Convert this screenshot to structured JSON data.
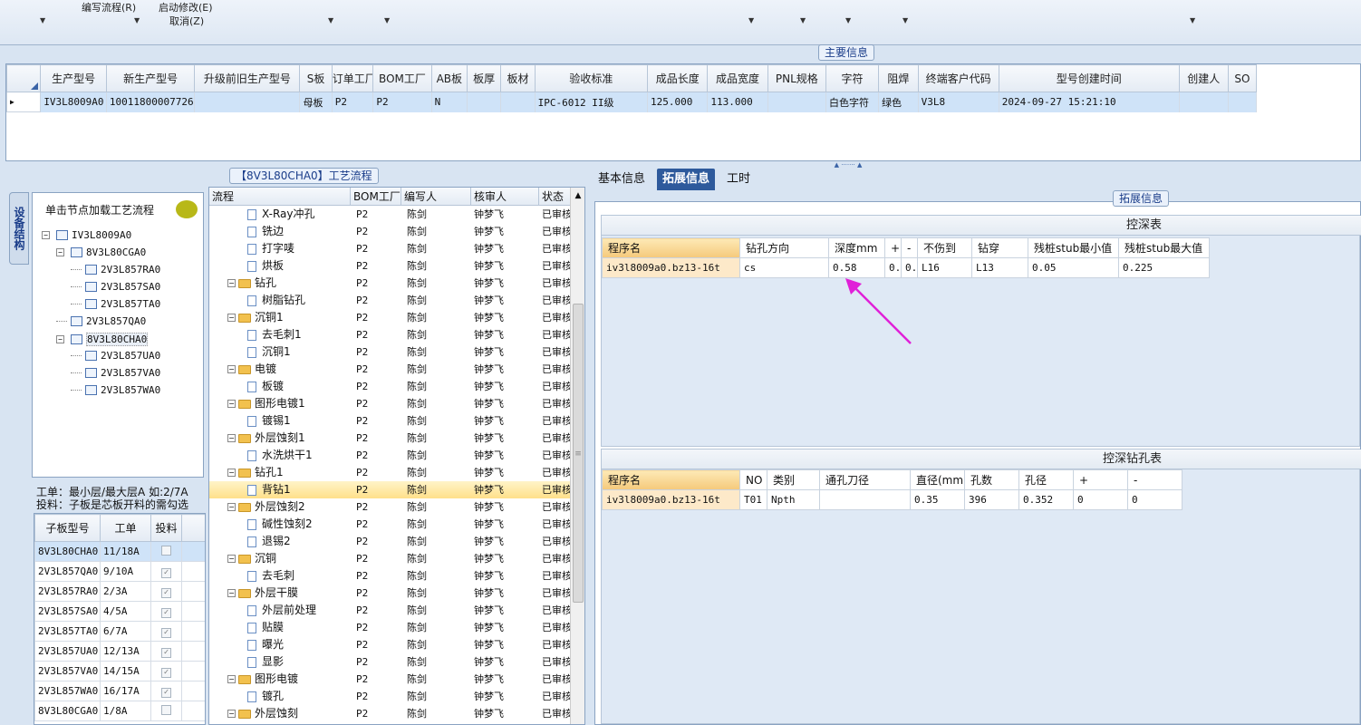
{
  "toolbar": {
    "edit_flow": "编写流程(R)",
    "start_modify": "启动修改(E)",
    "cancel": "取消(Z)"
  },
  "main_info": {
    "title": "主要信息",
    "columns": [
      "生产型号",
      "新生产型号",
      "升级前旧生产型号",
      "S板",
      "订单工厂",
      "BOM工厂",
      "AB板",
      "板厚",
      "板材",
      "验收标准",
      "成品长度",
      "成品宽度",
      "PNL规格",
      "字符",
      "阻焊",
      "终端客户代码",
      "型号创建时间",
      "创建人",
      "SO"
    ],
    "row": [
      "IV3L8009A0",
      "10011800007726",
      "",
      "母板",
      "P2",
      "P2",
      "N",
      "",
      "",
      "IPC-6012 II级",
      "125.000",
      "113.000",
      "",
      "白色字符",
      "绿色",
      "V3L8",
      "2024-09-27 15:21:10",
      "",
      ""
    ]
  },
  "left_panel": {
    "vtab": "设备结构",
    "hint": "单击节点加载工艺流程",
    "tree": [
      {
        "label": "IV3L8009A0",
        "level": 0
      },
      {
        "label": "8V3L80CGA0",
        "level": 1
      },
      {
        "label": "2V3L857RA0",
        "level": 2
      },
      {
        "label": "2V3L857SA0",
        "level": 2
      },
      {
        "label": "2V3L857TA0",
        "level": 2
      },
      {
        "label": "2V3L857QA0",
        "level": 1
      },
      {
        "label": "8V3L80CHA0",
        "level": 1
      },
      {
        "label": "2V3L857UA0",
        "level": 2
      },
      {
        "label": "2V3L857VA0",
        "level": 2
      },
      {
        "label": "2V3L857WA0",
        "level": 2
      }
    ],
    "note1": "工单：最小层/最大层A 如:2/7A",
    "note2": "投料：子板是芯板开料的需勾选",
    "sub_columns": [
      "子板型号",
      "工单",
      "投料"
    ],
    "sub_rows": [
      {
        "model": "8V3L80CHA0",
        "order": "11/18A",
        "checked": false
      },
      {
        "model": "2V3L857QA0",
        "order": "9/10A",
        "checked": true
      },
      {
        "model": "2V3L857RA0",
        "order": "2/3A",
        "checked": true
      },
      {
        "model": "2V3L857SA0",
        "order": "4/5A",
        "checked": true
      },
      {
        "model": "2V3L857TA0",
        "order": "6/7A",
        "checked": true
      },
      {
        "model": "2V3L857UA0",
        "order": "12/13A",
        "checked": true
      },
      {
        "model": "2V3L857VA0",
        "order": "14/15A",
        "checked": true
      },
      {
        "model": "2V3L857WA0",
        "order": "16/17A",
        "checked": true
      },
      {
        "model": "8V3L80CGA0",
        "order": "1/8A",
        "checked": false
      }
    ]
  },
  "process": {
    "title": "【8V3L80CHA0】工艺流程",
    "columns": [
      "流程",
      "BOM工厂",
      "编写人",
      "核审人",
      "状态"
    ],
    "rows": [
      {
        "name": "X-Ray冲孔",
        "folder": false,
        "bom": "P2",
        "writer": "陈剑",
        "reviewer": "钟梦飞",
        "status": "已审核"
      },
      {
        "name": "铣边",
        "folder": false,
        "bom": "P2",
        "writer": "陈剑",
        "reviewer": "钟梦飞",
        "status": "已审核"
      },
      {
        "name": "打字唛",
        "folder": false,
        "bom": "P2",
        "writer": "陈剑",
        "reviewer": "钟梦飞",
        "status": "已审核"
      },
      {
        "name": "烘板",
        "folder": false,
        "bom": "P2",
        "writer": "陈剑",
        "reviewer": "钟梦飞",
        "status": "已审核"
      },
      {
        "name": "钻孔",
        "folder": true,
        "bom": "P2",
        "writer": "陈剑",
        "reviewer": "钟梦飞",
        "status": "已审核"
      },
      {
        "name": "树脂钻孔",
        "folder": false,
        "bom": "P2",
        "writer": "陈剑",
        "reviewer": "钟梦飞",
        "status": "已审核"
      },
      {
        "name": "沉铜1",
        "folder": true,
        "bom": "P2",
        "writer": "陈剑",
        "reviewer": "钟梦飞",
        "status": "已审核"
      },
      {
        "name": "去毛刺1",
        "folder": false,
        "bom": "P2",
        "writer": "陈剑",
        "reviewer": "钟梦飞",
        "status": "已审核"
      },
      {
        "name": "沉铜1",
        "folder": false,
        "bom": "P2",
        "writer": "陈剑",
        "reviewer": "钟梦飞",
        "status": "已审核"
      },
      {
        "name": "电镀",
        "folder": true,
        "bom": "P2",
        "writer": "陈剑",
        "reviewer": "钟梦飞",
        "status": "已审核"
      },
      {
        "name": "板镀",
        "folder": false,
        "bom": "P2",
        "writer": "陈剑",
        "reviewer": "钟梦飞",
        "status": "已审核"
      },
      {
        "name": "图形电镀1",
        "folder": true,
        "bom": "P2",
        "writer": "陈剑",
        "reviewer": "钟梦飞",
        "status": "已审核"
      },
      {
        "name": "镀锡1",
        "folder": false,
        "bom": "P2",
        "writer": "陈剑",
        "reviewer": "钟梦飞",
        "status": "已审核"
      },
      {
        "name": "外层蚀刻1",
        "folder": true,
        "bom": "P2",
        "writer": "陈剑",
        "reviewer": "钟梦飞",
        "status": "已审核"
      },
      {
        "name": "水洗烘干1",
        "folder": false,
        "bom": "P2",
        "writer": "陈剑",
        "reviewer": "钟梦飞",
        "status": "已审核"
      },
      {
        "name": "钻孔1",
        "folder": true,
        "bom": "P2",
        "writer": "陈剑",
        "reviewer": "钟梦飞",
        "status": "已审核"
      },
      {
        "name": "背钻1",
        "folder": false,
        "bom": "P2",
        "writer": "陈剑",
        "reviewer": "钟梦飞",
        "status": "已审核",
        "selected": true
      },
      {
        "name": "外层蚀刻2",
        "folder": true,
        "bom": "P2",
        "writer": "陈剑",
        "reviewer": "钟梦飞",
        "status": "已审核"
      },
      {
        "name": "碱性蚀刻2",
        "folder": false,
        "bom": "P2",
        "writer": "陈剑",
        "reviewer": "钟梦飞",
        "status": "已审核"
      },
      {
        "name": "退锡2",
        "folder": false,
        "bom": "P2",
        "writer": "陈剑",
        "reviewer": "钟梦飞",
        "status": "已审核"
      },
      {
        "name": "沉铜",
        "folder": true,
        "bom": "P2",
        "writer": "陈剑",
        "reviewer": "钟梦飞",
        "status": "已审核"
      },
      {
        "name": "去毛刺",
        "folder": false,
        "bom": "P2",
        "writer": "陈剑",
        "reviewer": "钟梦飞",
        "status": "已审核"
      },
      {
        "name": "外层干膜",
        "folder": true,
        "bom": "P2",
        "writer": "陈剑",
        "reviewer": "钟梦飞",
        "status": "已审核"
      },
      {
        "name": "外层前处理",
        "folder": false,
        "bom": "P2",
        "writer": "陈剑",
        "reviewer": "钟梦飞",
        "status": "已审核"
      },
      {
        "name": "贴膜",
        "folder": false,
        "bom": "P2",
        "writer": "陈剑",
        "reviewer": "钟梦飞",
        "status": "已审核"
      },
      {
        "name": "曝光",
        "folder": false,
        "bom": "P2",
        "writer": "陈剑",
        "reviewer": "钟梦飞",
        "status": "已审核"
      },
      {
        "name": "显影",
        "folder": false,
        "bom": "P2",
        "writer": "陈剑",
        "reviewer": "钟梦飞",
        "status": "已审核"
      },
      {
        "name": "图形电镀",
        "folder": true,
        "bom": "P2",
        "writer": "陈剑",
        "reviewer": "钟梦飞",
        "status": "已审核"
      },
      {
        "name": "镀孔",
        "folder": false,
        "bom": "P2",
        "writer": "陈剑",
        "reviewer": "钟梦飞",
        "status": "已审核"
      },
      {
        "name": "外层蚀刻",
        "folder": true,
        "bom": "P2",
        "writer": "陈剑",
        "reviewer": "钟梦飞",
        "status": "已审核"
      }
    ]
  },
  "tabs": [
    "基本信息",
    "拓展信息",
    "工时"
  ],
  "ext": {
    "title": "拓展信息",
    "depth_table": {
      "caption": "控深表",
      "columns": [
        "程序名",
        "钻孔方向",
        "深度mm",
        "+",
        "-",
        "不伤到",
        "钻穿",
        "残桩stub最小值",
        "残桩stub最大值"
      ],
      "row": [
        "iv3l8009a0.bz13-16t",
        "cs",
        "0.58",
        "0..",
        "0..",
        "L16",
        "L13",
        "0.05",
        "0.225"
      ]
    },
    "drill_table": {
      "caption": "控深钻孔表",
      "columns": [
        "程序名",
        "NO",
        "类别",
        "通孔刀径",
        "直径(mm)",
        "孔数",
        "孔径",
        "+",
        "-"
      ],
      "row": [
        "iv3l8009a0.bz13-16t",
        "T01",
        "Npth",
        "",
        "0.35",
        "396",
        "0.352",
        "0",
        "0"
      ]
    }
  },
  "colors": {
    "accent": "#2e5a9c",
    "selection": "#cfe3f8",
    "highlight": "#ffe08a",
    "arrow": "#e020d8"
  }
}
